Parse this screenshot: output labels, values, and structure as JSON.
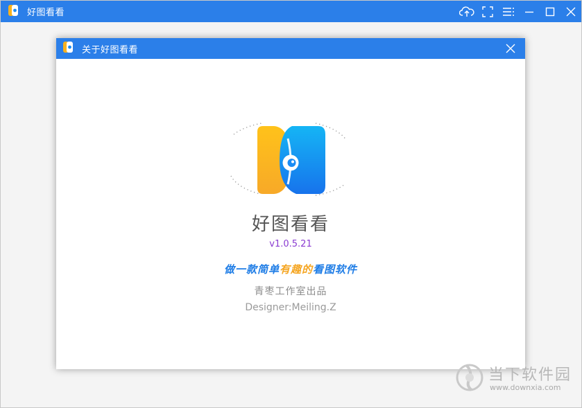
{
  "main_window": {
    "title": "好图看看",
    "controls": [
      "cloud-upload-icon",
      "fullscreen-icon",
      "menu-icon",
      "minimize-icon",
      "maximize-icon",
      "close-icon"
    ]
  },
  "about_dialog": {
    "title": "关于好图看看",
    "app_name": "好图看看",
    "version": "v1.0.5.21",
    "slogan_parts": {
      "a": "做一款简单",
      "b": "有趣的",
      "c": "看图软件"
    },
    "studio": "青枣工作室出品",
    "designer": "Designer:Meiling.Z"
  },
  "watermark": {
    "cn": "当下软件园",
    "en": "www.downxia.com"
  },
  "colors": {
    "titlebar": "#2b7fe9",
    "logo_orange": "#f7b21f",
    "logo_blue": "#1a8cf5",
    "version": "#8a3bd1"
  }
}
